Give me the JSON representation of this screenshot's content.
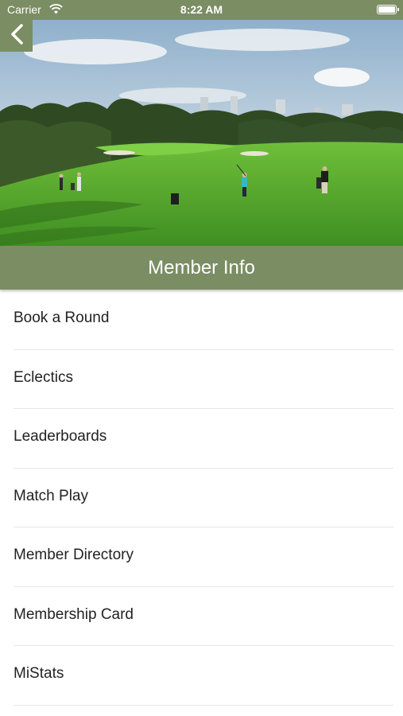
{
  "status_bar": {
    "carrier": "Carrier",
    "time": "8:22 AM"
  },
  "page": {
    "title": "Member Info"
  },
  "menu": {
    "items": [
      {
        "label": "Book a Round"
      },
      {
        "label": "Eclectics"
      },
      {
        "label": "Leaderboards"
      },
      {
        "label": "Match Play"
      },
      {
        "label": "Member Directory"
      },
      {
        "label": "Membership Card"
      },
      {
        "label": "MiStats"
      }
    ]
  },
  "colors": {
    "accent": "#7b8d63",
    "text": "#222222",
    "divider": "#e6e6e6"
  },
  "icons": {
    "back": "chevron-left-icon",
    "wifi": "wifi-icon",
    "battery": "battery-icon"
  },
  "images": {
    "hero": "golf course with golfers"
  }
}
